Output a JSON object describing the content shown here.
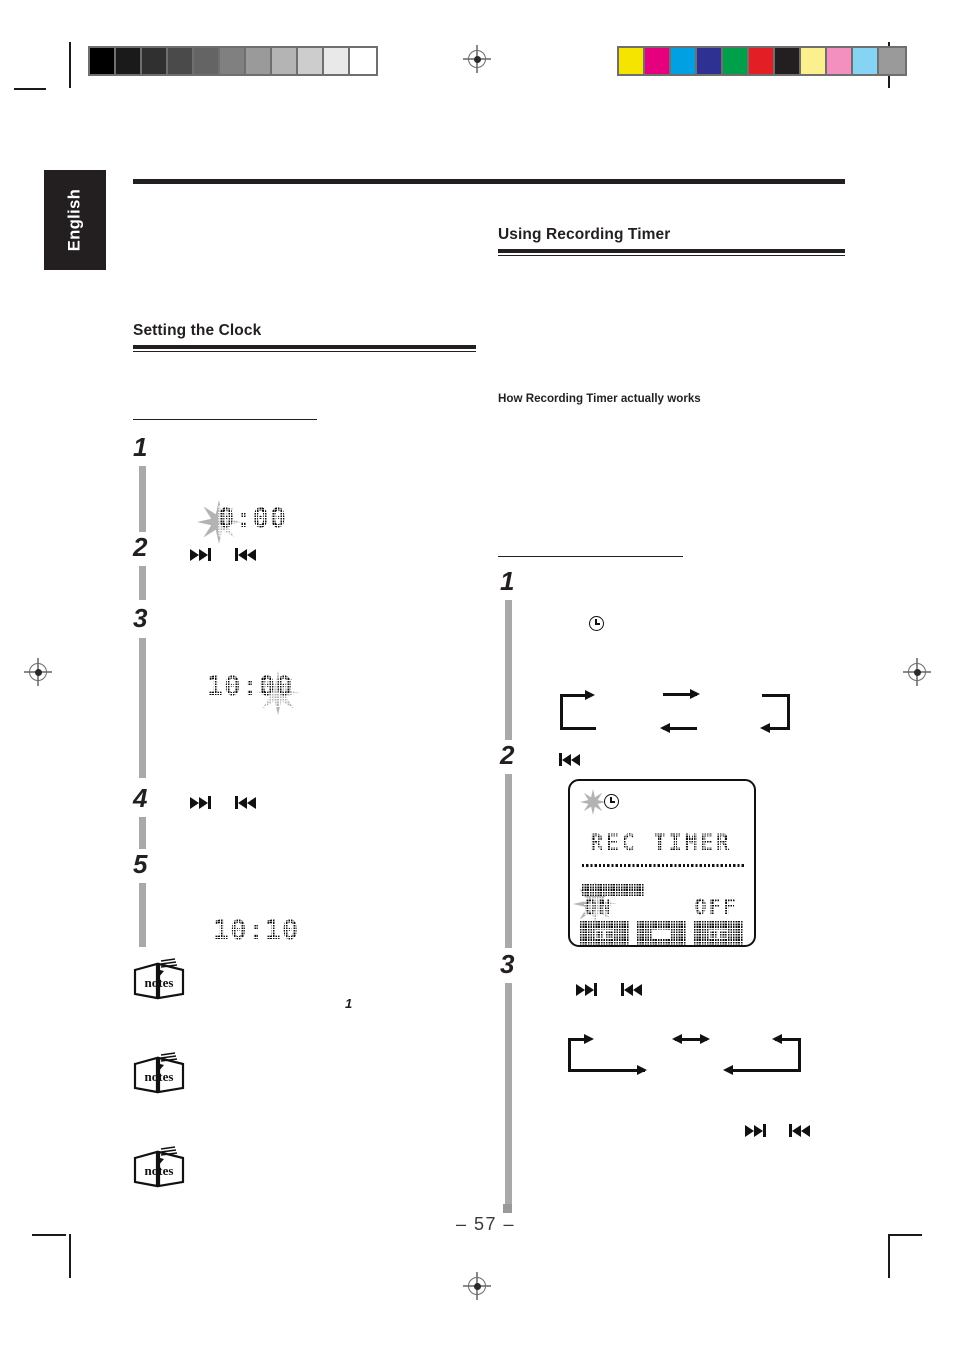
{
  "document": {
    "language_tab": "English",
    "page_number": "– 57 –",
    "note_marker": "1"
  },
  "calibration": {
    "grayscale_label": "grayscale-calibration-strip",
    "grayscale_swatches": [
      "#000000",
      "#1a1a1a",
      "#303030",
      "#4a4a4a",
      "#646464",
      "#808080",
      "#9a9a9a",
      "#b4b4b4",
      "#cdcdcd",
      "#e9e9e9",
      "#ffffff"
    ],
    "color_label": "color-calibration-strip",
    "color_swatches": [
      "#f5e400",
      "#e6007e",
      "#00a0e2",
      "#2e3191",
      "#00a04a",
      "#e31e24",
      "#231f20",
      "#fcef8d",
      "#f490c0",
      "#86d4f4",
      "#9a9a9a"
    ]
  },
  "left_column": {
    "heading": "Setting the Clock",
    "steps": [
      {
        "num": "1"
      },
      {
        "num": "2"
      },
      {
        "num": "3"
      },
      {
        "num": "4"
      },
      {
        "num": "5"
      }
    ],
    "displays": [
      {
        "name": "clock-display-hour-flashing",
        "value": "0:00",
        "flashing": "hour"
      },
      {
        "name": "clock-display-minute-flashing",
        "value": "10:00",
        "flashing": "minute"
      },
      {
        "name": "clock-display-set",
        "value": "10:10",
        "flashing": "none"
      }
    ],
    "transport_icons": [
      {
        "name": "skip-forward-icon",
        "glyph": "►►|"
      },
      {
        "name": "skip-back-icon",
        "glyph": "|◄◄"
      }
    ],
    "notes_label": "notes",
    "notes_count": 3
  },
  "right_column": {
    "heading": "Using Recording Timer",
    "subheading": "How Recording Timer actually works",
    "steps": [
      {
        "num": "1"
      },
      {
        "num": "2"
      },
      {
        "num": "3"
      }
    ],
    "lcd_panel": {
      "name": "rec-timer-lcd",
      "clock_indicator": "clock-icon",
      "title": "REC TIMER",
      "on_label": "ON",
      "off_label": "OFF",
      "segment_blocks": [
        "□□",
        "■■",
        "□□"
      ]
    },
    "transport_icons": [
      {
        "name": "skip-back-icon",
        "glyph": "|◄◄"
      },
      {
        "name": "skip-forward-icon",
        "glyph": "►►|"
      }
    ]
  }
}
